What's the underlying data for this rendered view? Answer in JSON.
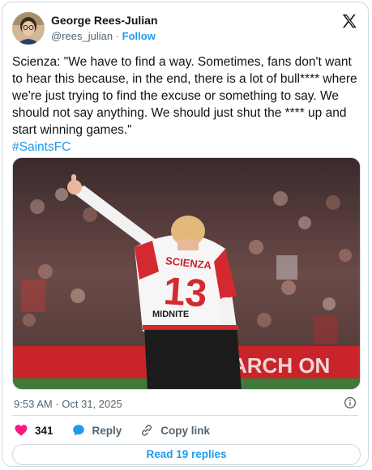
{
  "author": {
    "name": "George Rees-Julian",
    "handle": "@rees_julian",
    "separator": "·",
    "follow_label": "Follow"
  },
  "tweet": {
    "text": "Scienza: \"We have to find a way. Sometimes, fans don't want to hear this because, in the end, there is a lot of bull**** where we're just trying to find the excuse or something to say. We should not say anything. We should just shut the **** up and start winning games.\"",
    "hashtag": "#SaintsFC",
    "timestamp": "9:53 AM · Oct 31, 2025"
  },
  "media": {
    "shirt_name": "SCIENZA",
    "shirt_number": "13",
    "sponsor": "MIDNITE",
    "board_text": "ARCH ON"
  },
  "actions": {
    "like_count": "341",
    "reply_label": "Reply",
    "copy_link_label": "Copy link"
  },
  "footer": {
    "read_replies_label": "Read 19 replies"
  },
  "colors": {
    "accent": "#1d9bf0",
    "like": "#f91880",
    "text": "#0f1419",
    "muted": "#536471"
  }
}
